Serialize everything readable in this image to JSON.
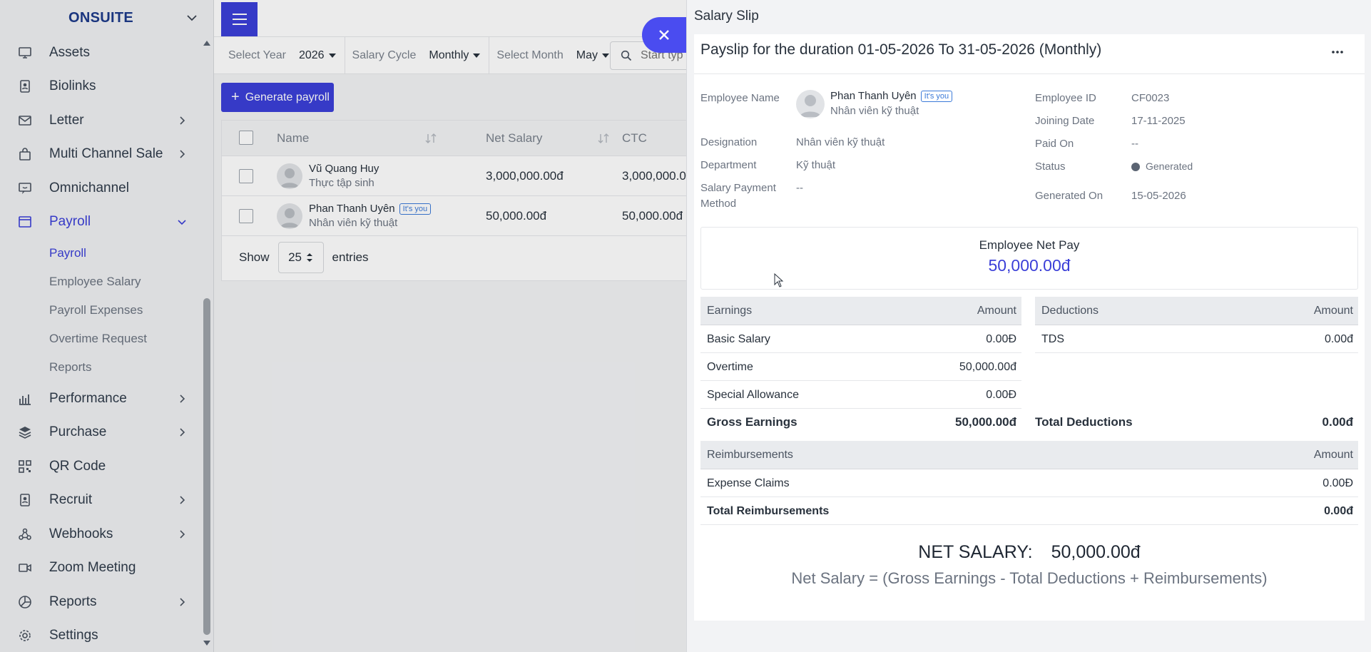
{
  "sidebar": {
    "brand": "ONSUITE",
    "items": [
      {
        "label": "Assets",
        "icon": "monitor-icon",
        "chevron": false
      },
      {
        "label": "Biolinks",
        "icon": "id-badge-icon",
        "chevron": false
      },
      {
        "label": "Letter",
        "icon": "envelope-icon",
        "chevron": true
      },
      {
        "label": "Multi Channel Sale",
        "icon": "shopping-bag-icon",
        "chevron": true
      },
      {
        "label": "Omnichannel",
        "icon": "chat-screen-icon",
        "chevron": false
      },
      {
        "label": "Payroll",
        "icon": "browser-window-icon",
        "chevron": true,
        "active": true
      },
      {
        "label": "Performance",
        "icon": "bar-chart-icon",
        "chevron": true
      },
      {
        "label": "Purchase",
        "icon": "layers-icon",
        "chevron": true
      },
      {
        "label": "QR Code",
        "icon": "qr-code-icon",
        "chevron": false
      },
      {
        "label": "Recruit",
        "icon": "id-badge-icon",
        "chevron": true
      },
      {
        "label": "Webhooks",
        "icon": "webhook-icon",
        "chevron": true
      },
      {
        "label": "Zoom Meeting",
        "icon": "video-camera-icon",
        "chevron": false
      },
      {
        "label": "Reports",
        "icon": "pie-chart-icon",
        "chevron": true
      },
      {
        "label": "Settings",
        "icon": "gear-icon",
        "chevron": false
      }
    ],
    "payroll_sub": [
      "Payroll",
      "Employee Salary",
      "Payroll Expenses",
      "Overtime Request",
      "Reports"
    ]
  },
  "filters": {
    "year_label": "Select Year",
    "year_value": "2026",
    "cycle_label": "Salary Cycle",
    "cycle_value": "Monthly",
    "month_label": "Select Month",
    "month_value": "May",
    "search_placeholder": "Start typ"
  },
  "generate_button": "Generate payroll",
  "table": {
    "headers": {
      "name": "Name",
      "net_salary": "Net Salary",
      "ctc": "CTC"
    },
    "rows": [
      {
        "name": "Vũ Quang Huy",
        "role": "Thực tập sinh",
        "net_salary": "3,000,000.00đ",
        "ctc": "3,000,000.0",
        "badge": ""
      },
      {
        "name": "Phan Thanh Uyên",
        "role": "Nhân viên kỹ thuật",
        "net_salary": "50,000.00đ",
        "ctc": "50,000.00đ",
        "badge": "It's you"
      }
    ],
    "show_label": "Show",
    "entries_value": "25",
    "entries_label": "entries"
  },
  "drawer": {
    "title": "Salary Slip",
    "payslip_title": "Payslip for the duration 01-05-2026 To 31-05-2026 (Monthly)",
    "employee_name_label": "Employee Name",
    "employee_name": "Phan Thanh Uyên",
    "employee_badge": "It's you",
    "employee_role": "Nhân viên kỹ thuật",
    "designation_label": "Designation",
    "designation": "Nhân viên kỹ thuật",
    "department_label": "Department",
    "department": "Kỹ thuật",
    "payment_method_label_1": "Salary Payment",
    "payment_method_label_2": "Method",
    "payment_method": "--",
    "employee_id_label": "Employee ID",
    "employee_id": "CF0023",
    "joining_date_label": "Joining Date",
    "joining_date": "17-11-2025",
    "paid_on_label": "Paid On",
    "paid_on": "--",
    "status_label": "Status",
    "status": "Generated",
    "status_color": "#5b6472",
    "generated_on_label": "Generated On",
    "generated_on": "15-05-2026",
    "net_pay_label": "Employee Net Pay",
    "net_pay_value": "50,000.00đ",
    "earnings": {
      "header": "Earnings",
      "amount_header": "Amount",
      "rows": [
        {
          "label": "Basic Salary",
          "amount": "0.00Đ"
        },
        {
          "label": "Overtime",
          "amount": "50,000.00đ"
        },
        {
          "label": "Special Allowance",
          "amount": "0.00Đ"
        }
      ],
      "total_label": "Gross Earnings",
      "total_value": "50,000.00đ"
    },
    "deductions": {
      "header": "Deductions",
      "amount_header": "Amount",
      "rows": [
        {
          "label": "TDS",
          "amount": "0.00đ"
        }
      ],
      "total_label": "Total Deductions",
      "total_value": "0.00đ"
    },
    "reimbursements": {
      "header": "Reimbursements",
      "amount_header": "Amount",
      "rows": [
        {
          "label": "Expense Claims",
          "amount": "0.00Đ"
        }
      ],
      "total_label": "Total Reimbursements",
      "total_value": "0.00đ"
    },
    "net_salary_label": "NET SALARY:",
    "net_salary_value": "50,000.00đ",
    "formula": "Net Salary = (Gross Earnings - Total Deductions + Reimbursements)"
  },
  "colors": {
    "accent": "#3b3fd8",
    "brand": "#1d3a8a",
    "close": "#4a4cf0"
  }
}
